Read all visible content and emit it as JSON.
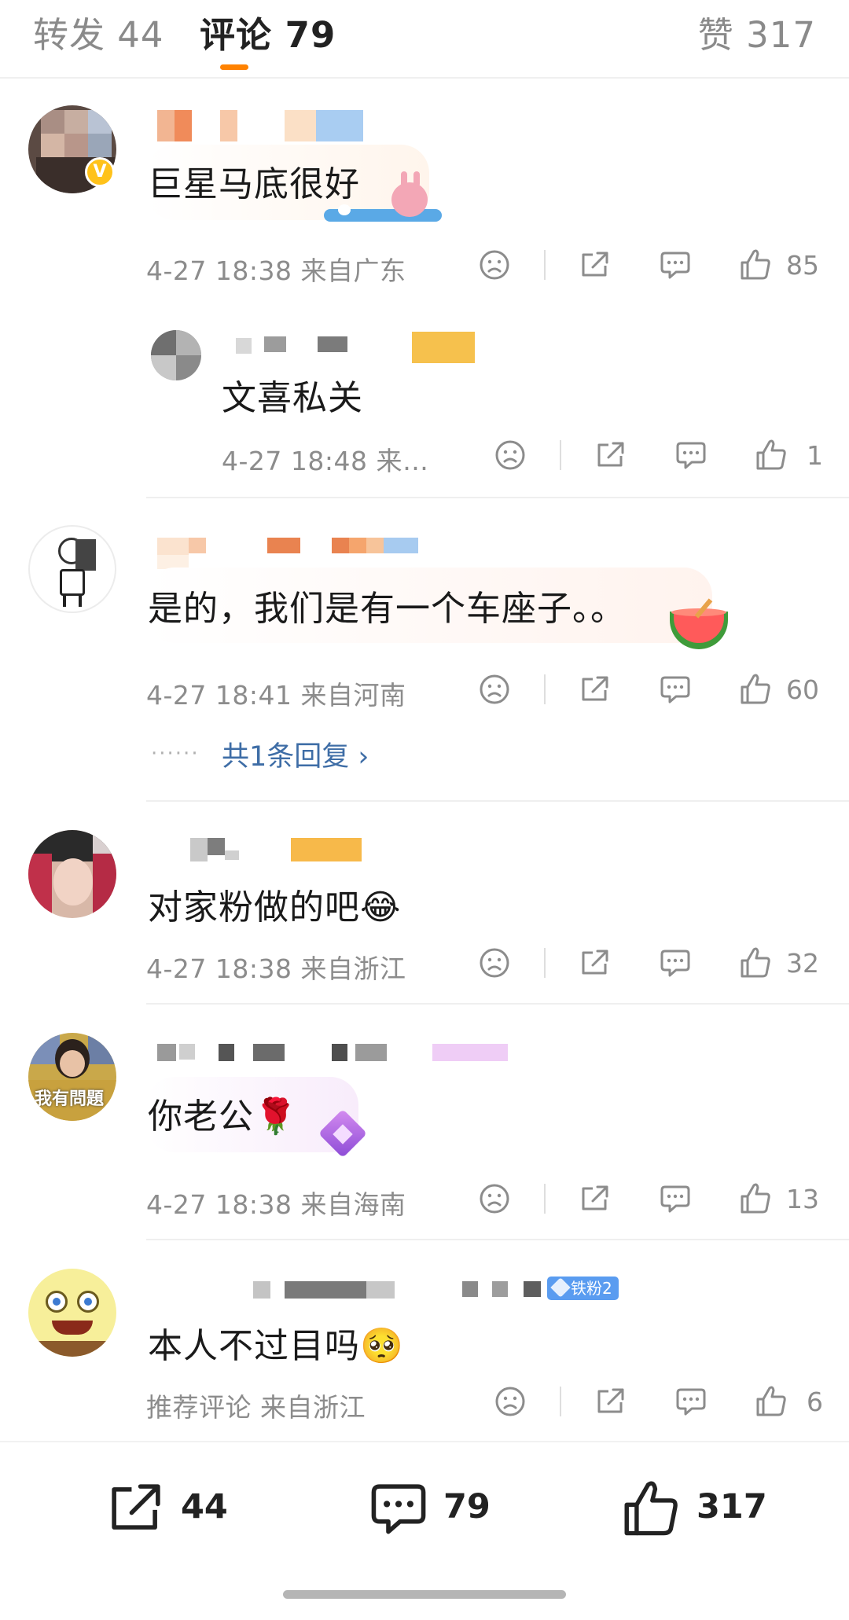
{
  "tabs": {
    "repost": "转发 44",
    "comments": "评论 79",
    "likes": "赞 317"
  },
  "comments": [
    {
      "text": "巨星马底很好",
      "meta": "4-27 18:38 来自广东",
      "likes": "85",
      "verified": "V"
    },
    {
      "text": "文喜私关",
      "meta": "4-27 18:48 来…",
      "likes": "1"
    },
    {
      "text": "是的，我们是有一个车座子。。",
      "meta": "4-27 18:41 来自河南",
      "likes": "60",
      "replies_link": "共1条回复 ›"
    },
    {
      "text": "对家粉做的吧😂",
      "meta": "4-27 18:38 来自浙江",
      "likes": "32"
    },
    {
      "text": "你老公🌹",
      "meta": "4-27 18:38 来自海南",
      "likes": "13",
      "avatar_text": "我有問題"
    },
    {
      "text": "本人不过目吗🥺",
      "meta": "推荐评论  来自浙江",
      "likes": "6",
      "fan_badge": "铁粉2"
    }
  ],
  "bottom_bar": {
    "repost_count": "44",
    "comment_count": "79",
    "like_count": "317"
  },
  "icons": {
    "dislike": "frown-face-icon",
    "share": "share-icon",
    "comment": "comment-bubble-icon",
    "like": "thumbs-up-icon"
  },
  "colors": {
    "accent": "#ff8200",
    "link": "#3e6da6",
    "meta_gray": "#8c8c8c",
    "fan_badge": "#5a9cf0"
  }
}
